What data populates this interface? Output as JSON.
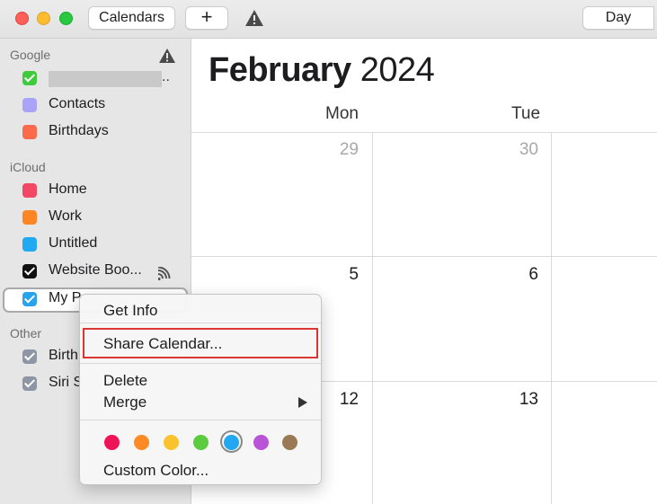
{
  "toolbar": {
    "calendars_label": "Calendars",
    "add_label": "+",
    "day_label": "Day"
  },
  "sidebar": {
    "sections": [
      {
        "label": "Google",
        "items": [
          {
            "label": "",
            "color": "#3ecb3e",
            "checked": true,
            "redacted": true,
            "trail": ".."
          },
          {
            "label": "Contacts",
            "color": "#a9a4f7",
            "checked": false
          },
          {
            "label": "Birthdays",
            "color": "#fb6a4b",
            "checked": false
          }
        ]
      },
      {
        "label": "iCloud",
        "items": [
          {
            "label": "Home",
            "color": "#f44765",
            "checked": false
          },
          {
            "label": "Work",
            "color": "#fd8523",
            "checked": false
          },
          {
            "label": "Untitled",
            "color": "#21aaf2",
            "checked": false
          },
          {
            "label": "Website Boo...",
            "color": "#111111",
            "checked": true
          },
          {
            "label": "My P",
            "color": "#29a3ee",
            "checked": true
          }
        ]
      },
      {
        "label": "Other",
        "items": [
          {
            "label": "Birth",
            "color": "#8e96a4",
            "checked": true
          },
          {
            "label": "Siri S",
            "color": "#8e96a4",
            "checked": true
          }
        ]
      }
    ]
  },
  "calendar": {
    "month": "February",
    "year": "2024",
    "weekdays": [
      "Mon",
      "Tue"
    ],
    "weeks": [
      [
        "29",
        "30"
      ],
      [
        "5",
        "6"
      ],
      [
        "12",
        "13"
      ]
    ]
  },
  "context_menu": {
    "get_info": "Get Info",
    "share_calendar": "Share Calendar...",
    "delete": "Delete",
    "merge": "Merge",
    "custom_color": "Custom Color...",
    "colors": [
      "#ee1457",
      "#fd8a25",
      "#fbc22f",
      "#5ccc3e",
      "#22a7f1",
      "#b954d6",
      "#9a7a55"
    ],
    "selected_color_index": 4
  }
}
